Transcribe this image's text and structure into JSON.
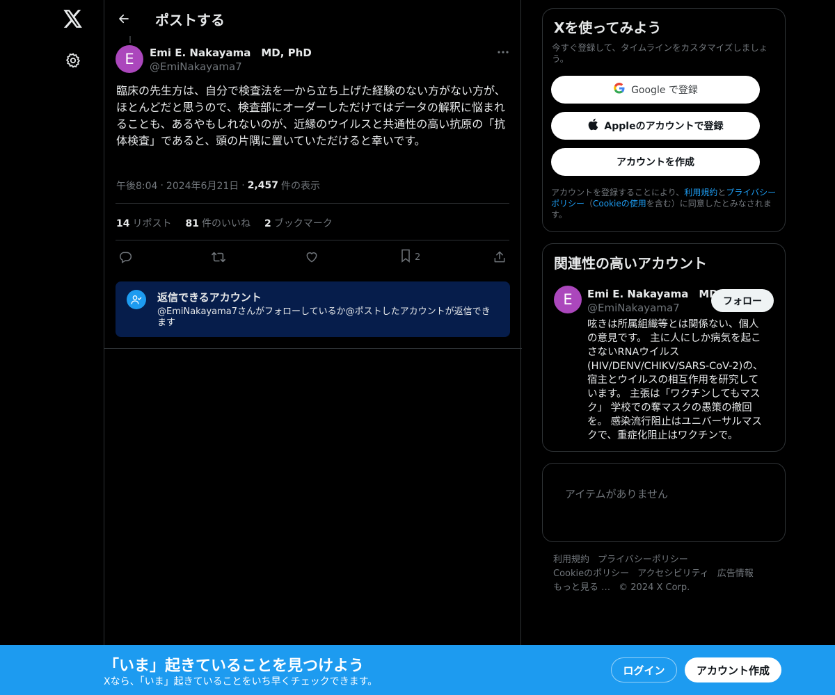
{
  "colors": {
    "accent": "#1d9bf0",
    "avatar": "#ab47bc",
    "background": "#000000",
    "reply_box": "#061d4b"
  },
  "header": {
    "title": "ポストする"
  },
  "post": {
    "avatar_initial": "E",
    "author_name": "Emi E. Nakayama　MD, PhD",
    "author_handle": "@EmiNakayama7",
    "text": "臨床の先生方は、自分で検査法を一から立ち上げた経験のない方がない方が、ほとんどだと思うので、検査部にオーダーしただけではデータの解釈に悩まれることも、あるやもしれないのが、近縁のウイルスと共通性の高い抗原の「抗体検査」であると、頭の片隅に置いていただけると幸いです。",
    "time": "午後8:04",
    "date": "2024年6月21日",
    "views_count": "2,457",
    "views_label": "件の表示",
    "reposts_count": "14",
    "reposts_label": "リポスト",
    "likes_count": "81",
    "likes_label": "件のいいね",
    "bookmarks_count": "2",
    "bookmarks_label": "ブックマーク",
    "bookmark_action_count": "2"
  },
  "reply_restriction": {
    "title": "返信できるアカウント",
    "description": "@EmiNakayama7さんがフォローしているか@ポストしたアカウントが返信できます"
  },
  "signup_card": {
    "title": "Xを使ってみよう",
    "subtitle": "今すぐ登録して、タイムラインをカスタマイズしましょう。",
    "google_label": "Google で登録",
    "apple_label": "Appleのアカウントで登録",
    "create_label": "アカウントを作成",
    "terms_prefix": "アカウントを登録することにより、",
    "terms_link": "利用規約",
    "terms_and": "と",
    "privacy_link": "プライバシーポリシー",
    "terms_paren_open": "（",
    "cookie_link": "Cookieの使用",
    "terms_suffix": "を含む）に同意したとみなされます。"
  },
  "related": {
    "title": "関連性の高いアカウント",
    "avatar_initial": "E",
    "name": "Emi E. Nakayama　MD",
    "handle": "@EmiNakayama7",
    "follow_label": "フォロー",
    "bio": "呟きは所属組織等とは関係ない、個人の意見です。 主に人にしか病気を起こさないRNAウイルス(HIV/DENV/CHIKV/SARS-CoV-2)の、宿主とウイルスの相互作用を研究しています。 主張は「ワクチンしてもマスク」 学校での奪マスクの愚策の撤回を。 感染流行阻止はユニバーサルマスクで、重症化阻止はワクチンで。"
  },
  "trends": {
    "empty_text": "アイテムがありません"
  },
  "footer": {
    "terms": "利用規約",
    "privacy": "プライバシーポリシー",
    "cookie": "Cookieのポリシー",
    "accessibility": "アクセシビリティ",
    "ads": "広告情報",
    "more": "もっと見る …",
    "copyright": "© 2024 X Corp."
  },
  "banner": {
    "title": "「いま」起きていることを見つけよう",
    "subtitle": "Xなら、「いま」起きていることをいち早くチェックできます。",
    "login_label": "ログイン",
    "signup_label": "アカウント作成"
  },
  "icons": [
    "x-logo-icon",
    "gear-icon",
    "back-arrow-icon",
    "more-icon",
    "reply-icon",
    "repost-icon",
    "like-icon",
    "bookmark-icon",
    "share-icon",
    "person-check-icon",
    "google-icon",
    "apple-icon"
  ]
}
